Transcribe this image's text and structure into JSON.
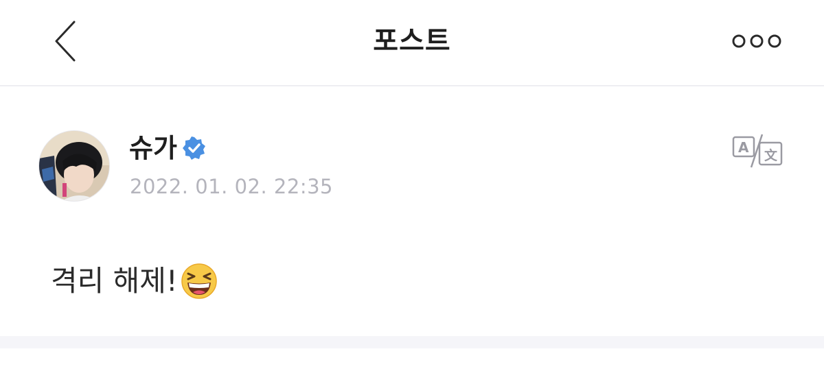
{
  "header": {
    "title": "포스트",
    "back_icon": "chevron-left-icon",
    "more_icon": "more-dots-icon"
  },
  "post": {
    "author": {
      "name": "슈가",
      "verified": true,
      "verified_color": "#4a90e2"
    },
    "timestamp": "2022. 01. 02. 22:35",
    "translate_icon": "translate-icon",
    "body_text": "격리 해제!",
    "emoji": "grinning-squinting-face-emoji"
  },
  "colors": {
    "title": "#1e1e1e",
    "timestamp": "#b4b4bc",
    "divider": "#f5f5f9",
    "icon_gray": "#9a9aa2"
  }
}
